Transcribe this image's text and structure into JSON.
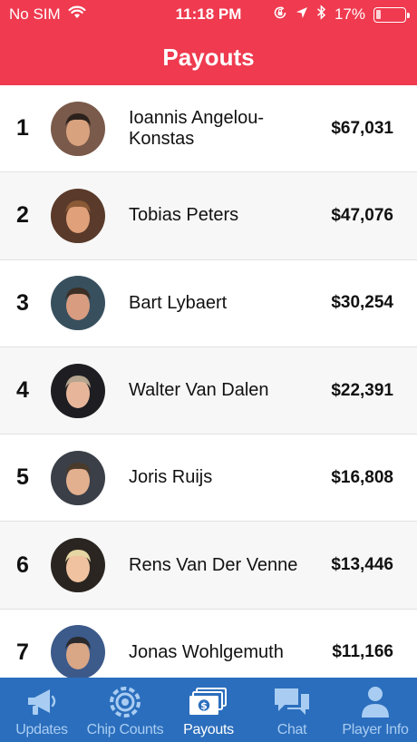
{
  "status_bar": {
    "carrier": "No SIM",
    "time": "11:18 PM",
    "battery_text": "17%",
    "battery_level": 0.17
  },
  "header": {
    "title": "Payouts"
  },
  "payouts": [
    {
      "rank": "1",
      "name": "Ioannis Angelou-Konstas",
      "amount": "$67,031",
      "avatar_bg": "#7a5a4a",
      "avatar_skin": "#d9a27e",
      "avatar_hair": "#2b211c"
    },
    {
      "rank": "2",
      "name": "Tobias Peters",
      "amount": "$47,076",
      "avatar_bg": "#5a3a2a",
      "avatar_skin": "#e0a07a",
      "avatar_hair": "#8a5a36"
    },
    {
      "rank": "3",
      "name": "Bart Lybaert",
      "amount": "$30,254",
      "avatar_bg": "#38505e",
      "avatar_skin": "#d89c80",
      "avatar_hair": "#3b2e25"
    },
    {
      "rank": "4",
      "name": "Walter Van Dalen",
      "amount": "$22,391",
      "avatar_bg": "#1e1e22",
      "avatar_skin": "#e7b69a",
      "avatar_hair": "#b5a48e"
    },
    {
      "rank": "5",
      "name": "Joris Ruijs",
      "amount": "$16,808",
      "avatar_bg": "#3a3f48",
      "avatar_skin": "#e2b08e",
      "avatar_hair": "#4a3a2c"
    },
    {
      "rank": "6",
      "name": "Rens Van Der Venne",
      "amount": "$13,446",
      "avatar_bg": "#2a2520",
      "avatar_skin": "#f0c2a0",
      "avatar_hair": "#e6d6a4"
    },
    {
      "rank": "7",
      "name": "Jonas Wohlgemuth",
      "amount": "$11,166",
      "avatar_bg": "#3c5a8a",
      "avatar_skin": "#d9a686",
      "avatar_hair": "#2a2a2e"
    }
  ],
  "tabs": [
    {
      "label": "Updates",
      "icon": "megaphone-icon",
      "active": false
    },
    {
      "label": "Chip Counts",
      "icon": "chip-icon",
      "active": false
    },
    {
      "label": "Payouts",
      "icon": "money-icon",
      "active": true
    },
    {
      "label": "Chat",
      "icon": "chat-bubbles-icon",
      "active": false
    },
    {
      "label": "Player Info",
      "icon": "person-icon",
      "active": false
    }
  ],
  "colors": {
    "header_bg": "#ef3a4f",
    "tabbar_bg": "#2b6ebd",
    "tab_active": "#ffffff",
    "tab_inactive": "#a9cdf2"
  }
}
